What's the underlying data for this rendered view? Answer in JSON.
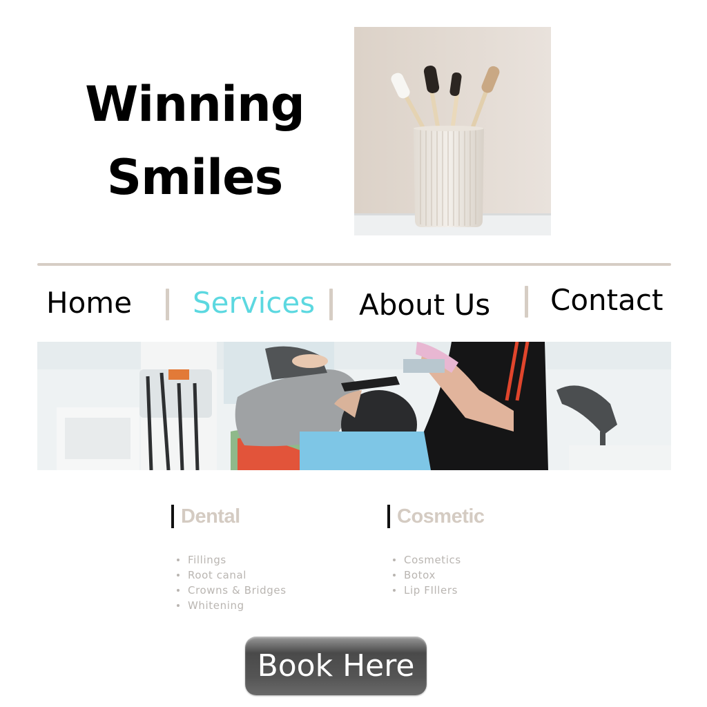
{
  "site": {
    "title_line1": "Winning",
    "title_line2": "Smiles"
  },
  "nav": {
    "items": [
      {
        "label": "Home",
        "active": false
      },
      {
        "label": "Services",
        "active": true
      },
      {
        "label": "About Us",
        "active": false
      },
      {
        "label": "Contact",
        "active": false
      }
    ],
    "active_color": "#5cd8e0",
    "separator_color": "#d6cdc4"
  },
  "services": {
    "dental": {
      "title": "Dental",
      "items": [
        "Fillings",
        "Root canal",
        "Crowns & Bridges",
        "Whitening"
      ]
    },
    "cosmetic": {
      "title": "Cosmetic",
      "items": [
        "Cosmetics",
        "Botox",
        "Lip FIllers"
      ]
    },
    "heading_color": "#d4cbc2"
  },
  "cta": {
    "label": "Book Here"
  },
  "images": {
    "hero": "toothbrushes-in-cup-photo",
    "banner": "dental-checkup-photo"
  }
}
